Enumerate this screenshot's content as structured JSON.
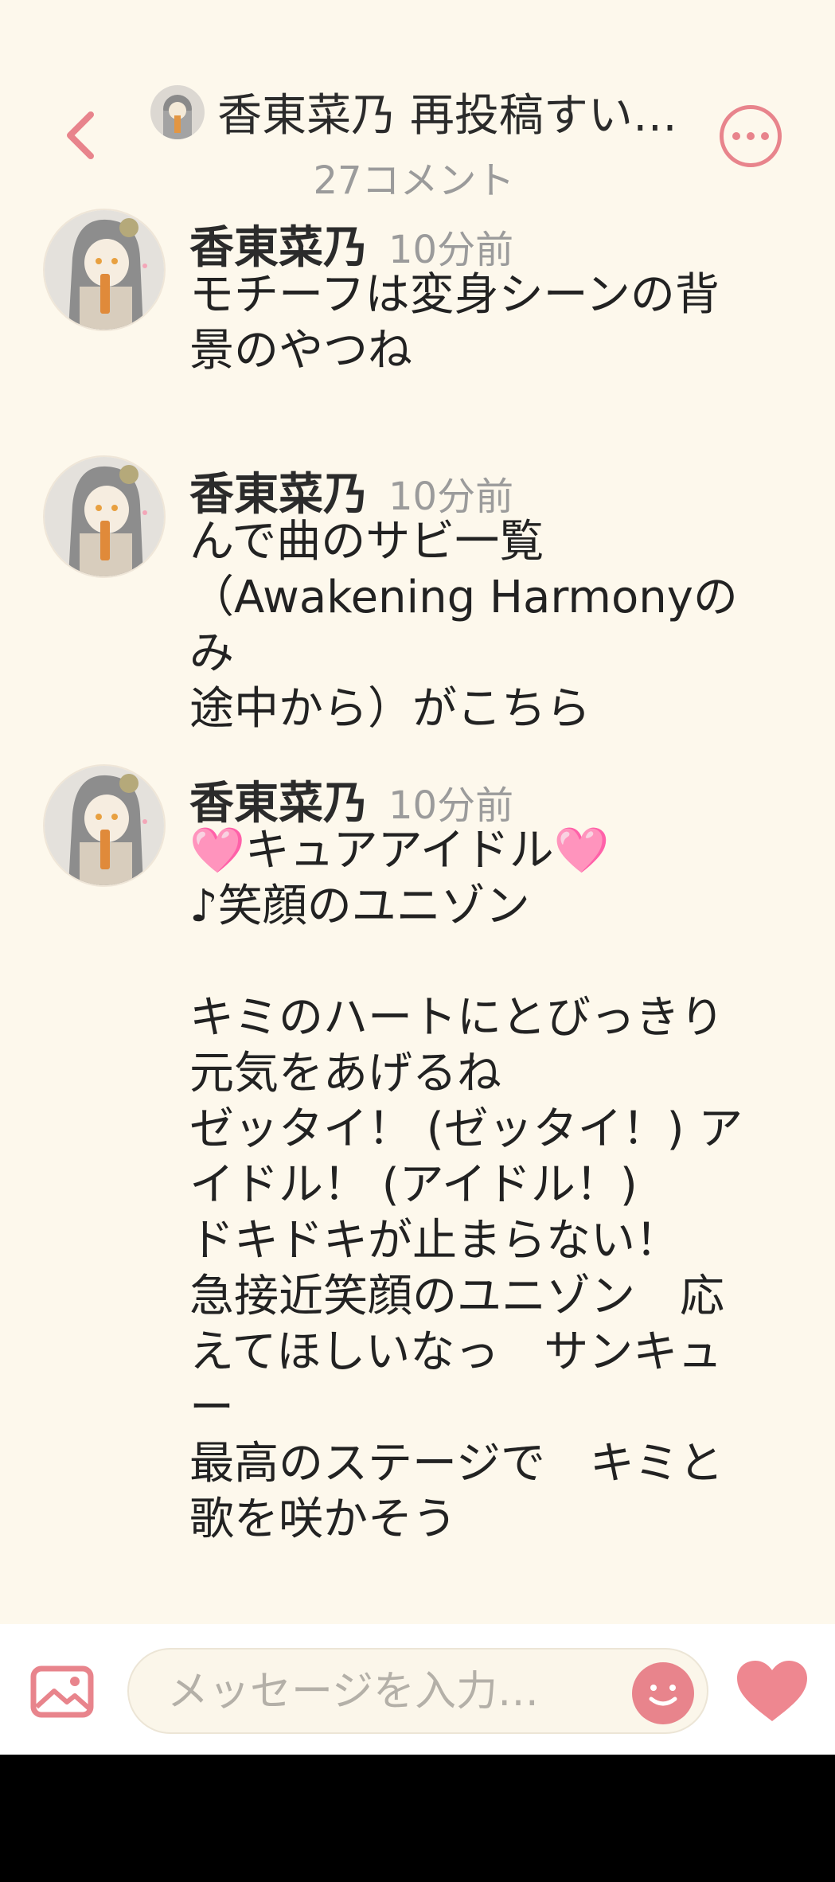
{
  "header": {
    "title": "香東菜乃 再投稿すい…",
    "subtitle": "27コメント",
    "back_icon": "chevron-left-icon",
    "more_icon": "more-dots-icon",
    "accent_color": "#e8848c"
  },
  "comments": [
    {
      "name": "香東菜乃",
      "time": "10分前",
      "lines": [
        "モチーフは変身シーンの背",
        "景のやつね"
      ]
    },
    {
      "name": "香東菜乃",
      "time": "10分前",
      "lines": [
        "んで曲のサビ一覧",
        "（Awakening Harmonyのみ",
        "途中から）がこちら"
      ]
    },
    {
      "name": "香東菜乃",
      "time": "10分前",
      "lines": [
        "🩷キュアアイドル🩷",
        "♪笑顔のユニゾン",
        "",
        "キミのハートにとびっきり",
        "元気をあげるね",
        "ゼッタイ！ (ゼッタイ！) ア",
        "イドル！ (アイドル！)",
        "ドキドキが止まらない！",
        "急接近笑顔のユニゾン　応",
        "えてほしいなっ　サンキュ",
        "ー",
        "最高のステージで　キミと",
        "歌を咲かそう"
      ]
    }
  ],
  "input_bar": {
    "placeholder": "メッセージを入力…",
    "image_icon": "image-icon",
    "emoji_icon": "smile-icon",
    "like_icon": "heart-icon"
  }
}
